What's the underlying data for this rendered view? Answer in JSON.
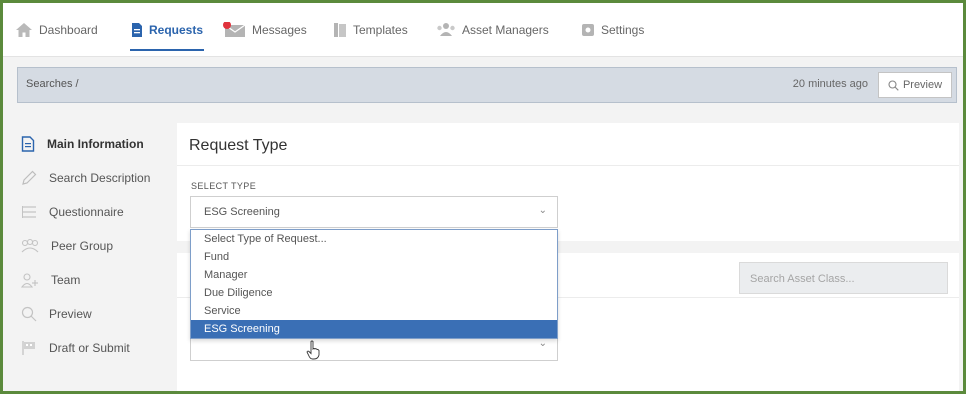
{
  "nav": {
    "items": [
      {
        "label": "Dashboard",
        "icon": "home-icon"
      },
      {
        "label": "Requests",
        "icon": "document-icon",
        "active": true
      },
      {
        "label": "Messages",
        "icon": "envelope-icon",
        "badge_color": "#e0323c"
      },
      {
        "label": "Templates",
        "icon": "templates-icon"
      },
      {
        "label": "Asset Managers",
        "icon": "users-icon"
      },
      {
        "label": "Settings",
        "icon": "gear-icon"
      }
    ]
  },
  "breadcrumb": {
    "text": "Searches /",
    "updated": "20 minutes ago",
    "preview_label": "Preview"
  },
  "sidebar": {
    "items": [
      {
        "label": "Main Information",
        "icon": "document-icon",
        "active": true
      },
      {
        "label": "Search Description",
        "icon": "pencil-icon"
      },
      {
        "label": "Questionnaire",
        "icon": "list-icon"
      },
      {
        "label": "Peer Group",
        "icon": "peers-icon"
      },
      {
        "label": "Team",
        "icon": "add-user-icon"
      },
      {
        "label": "Preview",
        "icon": "search-icon"
      },
      {
        "label": "Draft or Submit",
        "icon": "flag-icon"
      }
    ]
  },
  "request_type": {
    "title": "Request Type",
    "select_label": "SELECT TYPE",
    "selected": "ESG Screening",
    "options": [
      "Select Type of Request...",
      "Fund",
      "Manager",
      "Due Diligence",
      "Service",
      "ESG Screening"
    ]
  },
  "asset_class": {
    "search_placeholder": "Search Asset Class..."
  },
  "colors": {
    "accent": "#2b64ad",
    "selected_option": "#3a6fb5",
    "frame_border": "#5b8a3c"
  }
}
